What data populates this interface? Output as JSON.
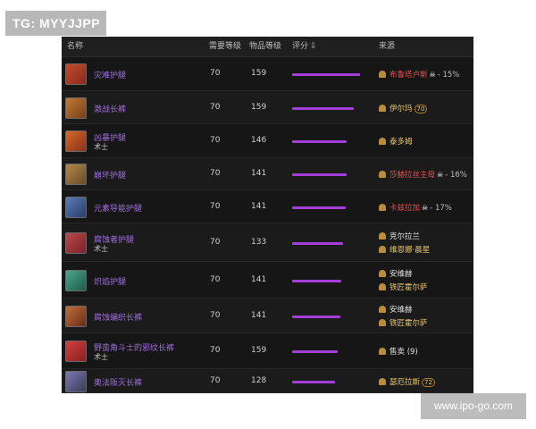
{
  "watermark_top": "TG: MYYJJPP",
  "watermark_bottom": "www.ipo-go.com",
  "headers": {
    "name": "名称",
    "req_level": "需要等级",
    "item_level": "物品等级",
    "score": "评分",
    "source": "来源"
  },
  "rows": [
    {
      "name": "灾难护腿",
      "sub": "",
      "req": "70",
      "ilvl": "159",
      "score_pct": 0.97,
      "src": [
        {
          "text": "布鲁塔卢斯",
          "cls": "red",
          "skull": true,
          "pct": "- 15%"
        }
      ]
    },
    {
      "name": "激战长裤",
      "sub": "",
      "req": "70",
      "ilvl": "159",
      "score_pct": 0.88,
      "src": [
        {
          "text": "伊尔玛",
          "cls": "gold",
          "badge": "70"
        }
      ]
    },
    {
      "name": "凶暴护腿",
      "sub": "术士",
      "req": "70",
      "ilvl": "146",
      "score_pct": 0.78,
      "src": [
        {
          "text": "泰多姆",
          "cls": "gold"
        }
      ]
    },
    {
      "name": "崩坏护腿",
      "sub": "",
      "req": "70",
      "ilvl": "141",
      "score_pct": 0.78,
      "src": [
        {
          "text": "莎赫拉丝主母",
          "cls": "red",
          "skull": true,
          "pct": "- 16%"
        }
      ]
    },
    {
      "name": "元素导能护腿",
      "sub": "",
      "req": "70",
      "ilvl": "141",
      "score_pct": 0.77,
      "src": [
        {
          "text": "卡兹拉加",
          "cls": "red",
          "skull": true,
          "pct": "- 17%"
        }
      ]
    },
    {
      "name": "腐蚀者护腿",
      "sub": "术士",
      "req": "70",
      "ilvl": "133",
      "score_pct": 0.73,
      "src": [
        {
          "text": "克尔拉兰",
          "cls": "white"
        },
        {
          "text": "维恩娜·晨星",
          "cls": "gold"
        }
      ]
    },
    {
      "name": "炽焰护腿",
      "sub": "",
      "req": "70",
      "ilvl": "141",
      "score_pct": 0.71,
      "src": [
        {
          "text": "安维赫",
          "cls": "white"
        },
        {
          "text": "铁匠霍尔萨",
          "cls": "gold"
        }
      ]
    },
    {
      "name": "腐蚀编织长裤",
      "sub": "",
      "req": "70",
      "ilvl": "141",
      "score_pct": 0.69,
      "src": [
        {
          "text": "安维赫",
          "cls": "white"
        },
        {
          "text": "铁匠霍尔萨",
          "cls": "gold"
        }
      ]
    },
    {
      "name": "野蛮角斗士的邪纹长裤",
      "sub": "术士",
      "req": "70",
      "ilvl": "159",
      "score_pct": 0.66,
      "src": [
        {
          "text": "售卖",
          "cls": "white",
          "suffix": " (9)"
        }
      ]
    },
    {
      "name": "奥法阪灭长裤",
      "sub": "",
      "req": "70",
      "ilvl": "128",
      "score_pct": 0.61,
      "src": [
        {
          "text": "瑟厄拉斯",
          "cls": "gold",
          "badge": "72"
        }
      ]
    }
  ]
}
